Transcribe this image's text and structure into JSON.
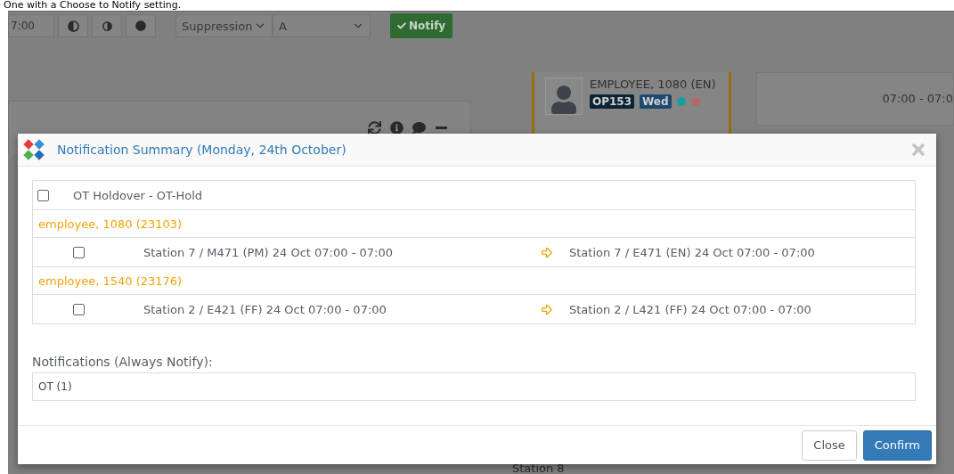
{
  "doc_caption": "One with a Choose to Notify setting.",
  "toolbar": {
    "time_value": "7:00",
    "suppression_select": "Suppression",
    "group_select": "A",
    "notify_button": "Notify"
  },
  "employee_card": {
    "name": "EMPLOYEE, 1080 (EN)",
    "badges": [
      {
        "label": "OP153",
        "color": "#0a2433"
      },
      {
        "label": "Wed",
        "color": "#1f4a70"
      }
    ],
    "status_dots": [
      {
        "color": "#14a0a0"
      },
      {
        "color": "#b06a6a"
      }
    ]
  },
  "shift_card": {
    "time": "07:00 - 07:0"
  },
  "station_heading": "Station 8",
  "dialog": {
    "title": "Notification Summary (Monday, 24th October)",
    "items": [
      {
        "kind": "option",
        "label": "OT Holdover - OT-Hold",
        "checked": false
      },
      {
        "kind": "employee",
        "label": "employee, 1080 (23103)"
      },
      {
        "kind": "swap",
        "checked": false,
        "from": "Station 7 / M471 (PM) 24 Oct 07:00 - 07:00",
        "to": "Station 7 / E471 (EN) 24 Oct 07:00 - 07:00"
      },
      {
        "kind": "employee",
        "label": "employee, 1540 (23176)"
      },
      {
        "kind": "swap",
        "checked": false,
        "from": "Station 2 / E421 (FF) 24 Oct 07:00 - 07:00",
        "to": "Station 2 / L421 (FF) 24 Oct 07:00 - 07:00"
      }
    ],
    "always_notify_label": "Notifications (Always Notify):",
    "always_notify_value": "OT (1)",
    "buttons": [
      {
        "label": "Close",
        "kind": "default"
      },
      {
        "label": "Confirm",
        "kind": "primary"
      }
    ]
  }
}
